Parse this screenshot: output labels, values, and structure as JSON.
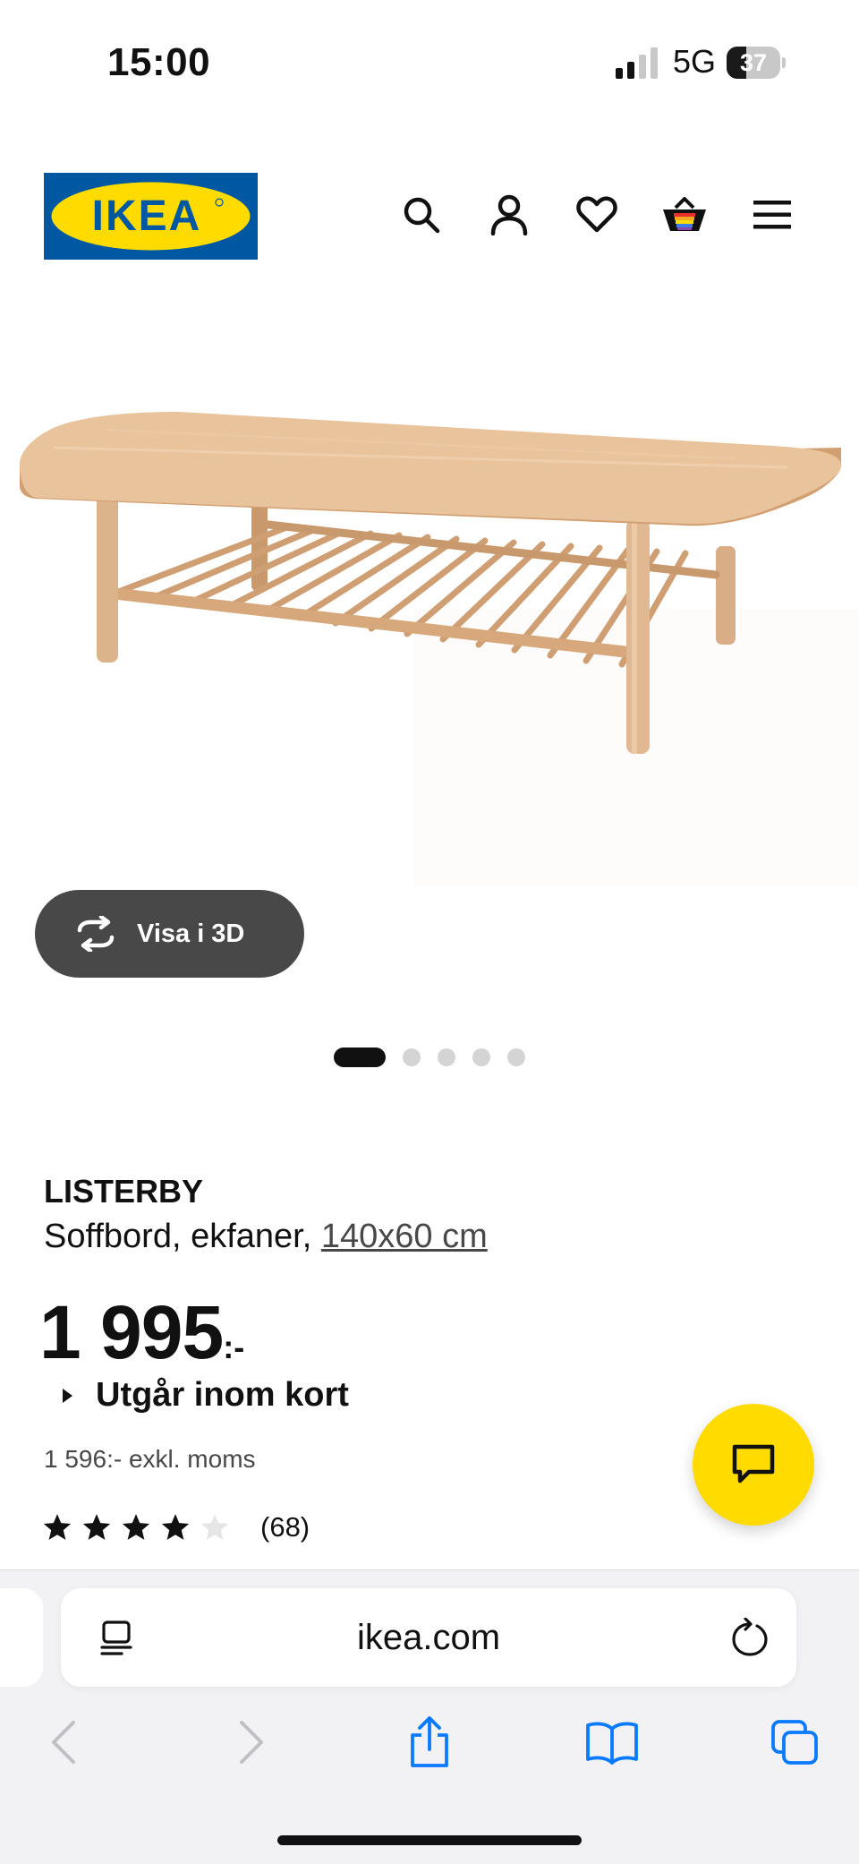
{
  "status_bar": {
    "time": "15:00",
    "network": "5G",
    "battery": "37",
    "battery_level": 0.37
  },
  "header": {
    "logo_text": "IKEA",
    "icons": [
      "search-icon",
      "account-icon",
      "heart-icon",
      "basket-icon",
      "menu-icon"
    ]
  },
  "gallery": {
    "view_3d_label": "Visa i 3D",
    "image_count": 5,
    "active_index": 0
  },
  "product": {
    "name": "LISTERBY",
    "description": "Soffbord, ekfaner, ",
    "size_link": "140x60 cm",
    "price": "1 995",
    "price_suffix": ":-",
    "availability": "Utgår inom kort",
    "price_ex_vat": "1 596:- exkl. moms",
    "rating_value": 4,
    "rating_max": 5,
    "review_count": "(68)"
  },
  "browser": {
    "url": "ikea.com",
    "nav_icons": [
      "back-icon",
      "forward-icon",
      "share-icon",
      "bookmarks-icon",
      "tabs-icon"
    ]
  },
  "colors": {
    "ikea_blue": "#0058a3",
    "ikea_yellow": "#ffdb00",
    "safari_blue": "#0a7aff",
    "wood": "#dcb48c"
  }
}
